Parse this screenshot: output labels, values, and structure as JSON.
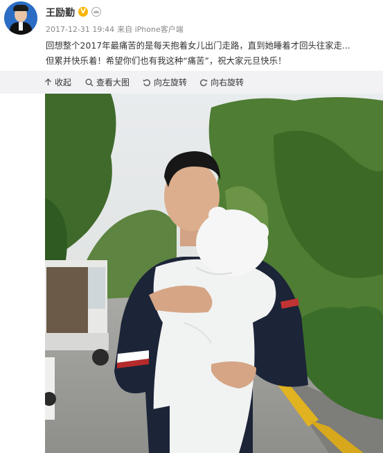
{
  "post": {
    "author": "王励勤",
    "verified_badge": "V",
    "timestamp": "2017-12-31 19:44",
    "source": "来自 iPhone客户端",
    "text_lines": [
      "回想整个2017年最痛苦的是每天抱着女儿出门走路，直到她睡着才回头往家走...",
      "但累并快乐着！希望你们也有我这种“痛苦”，祝大家元旦快乐！"
    ]
  },
  "toolbar": {
    "collapse": "收起",
    "view_large": "查看大图",
    "rotate_left": "向左旋转",
    "rotate_right": "向右旋转"
  },
  "colors": {
    "toolbar_bg": "#f2f2f5",
    "badge": "#f7b500",
    "avatar_bg": "#2b6cc4"
  }
}
